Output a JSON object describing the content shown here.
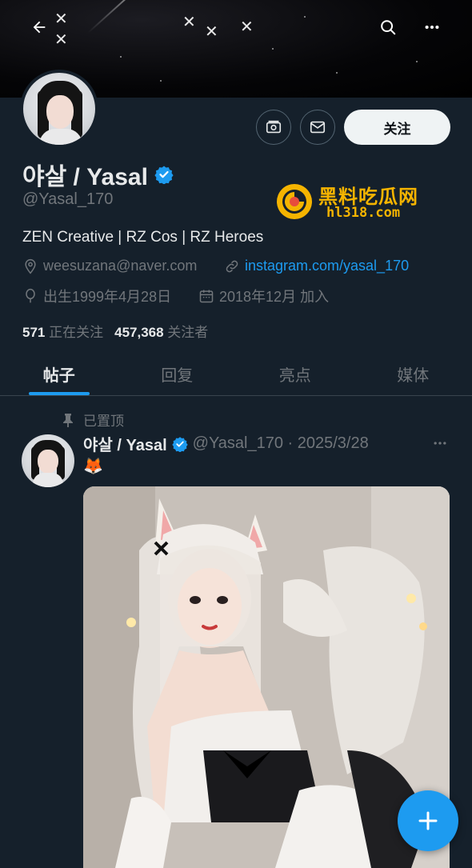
{
  "profile": {
    "name": "야살 / Yasal",
    "handle": "@Yasal_170",
    "bio": "ZEN Creative | RZ Cos | RZ Heroes",
    "email": "weesuzana@naver.com",
    "link": "instagram.com/yasal_170",
    "birth": "出生1999年4月28日",
    "joined": "2018年12月 加入",
    "following_count": "571",
    "following_label": "正在关注",
    "followers_count": "457,368",
    "followers_label": "关注者",
    "follow_label": "关注"
  },
  "tabs": [
    {
      "label": "帖子",
      "active": true
    },
    {
      "label": "回复",
      "active": false
    },
    {
      "label": "亮点",
      "active": false
    },
    {
      "label": "媒体",
      "active": false
    }
  ],
  "post": {
    "pinned_label": "已置顶",
    "author": "야살 / Yasal",
    "handle_date": "@Yasal_170 · 2025/3/28",
    "text": "🦊"
  },
  "watermark": {
    "title": "黑料吃瓜网",
    "url": "hl318.com"
  },
  "colors": {
    "background": "#15202b",
    "accent": "#1d9bf0",
    "muted": "#71767b",
    "text": "#e7e9ea"
  },
  "icons": [
    "back-arrow-icon",
    "search-icon",
    "more-icon",
    "tip-jar-icon",
    "mail-icon",
    "verified-badge-icon",
    "location-icon",
    "link-icon",
    "balloon-icon",
    "calendar-icon",
    "pin-icon",
    "compose-plus-icon"
  ]
}
